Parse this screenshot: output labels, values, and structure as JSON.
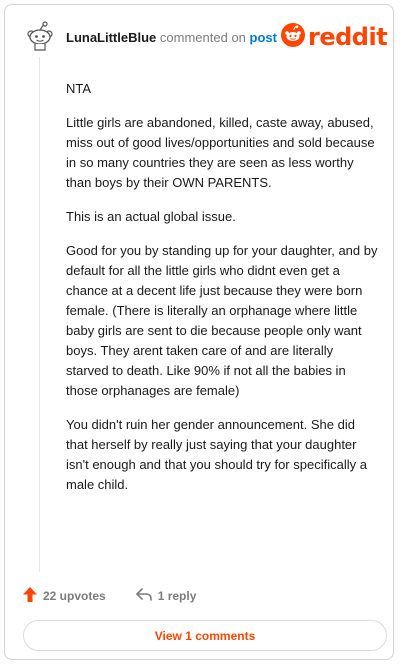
{
  "header": {
    "username": "LunaLittleBlue",
    "commented_on": "commented on",
    "post_link": "post",
    "brand": "reddit"
  },
  "comment": {
    "paragraphs": [
      "NTA",
      "Little girls are abandoned, killed, caste away, abused, miss out of good lives/opportunities and sold because in so many countries they are seen as less worthy than boys by their OWN PARENTS.",
      "This is an actual global issue.",
      "Good for you by standing up for your daughter, and by default for all the little girls who didnt even get a chance at a decent life just because they were born female. (There is literally an orphanage where little baby girls are sent to die because people only want boys. They arent taken care of and are literally starved to death. Like 90% if not all the babies in those orphanages are female)",
      "You didn't ruin her gender announcement. She did that herself by really just saying that your daughter isn't enough and that you should try for specifically a male child."
    ]
  },
  "actions": {
    "upvotes": "22 upvotes",
    "replies": "1 reply",
    "view_comments": "View 1 comments"
  },
  "colors": {
    "brand": "#ff4500",
    "link": "#0079d3",
    "muted": "#7c7c7c"
  },
  "icons": {
    "avatar": "snoo-avatar-icon",
    "logo": "reddit-snoo-icon",
    "upvote": "upvote-arrow-icon",
    "reply": "reply-arrow-icon"
  }
}
